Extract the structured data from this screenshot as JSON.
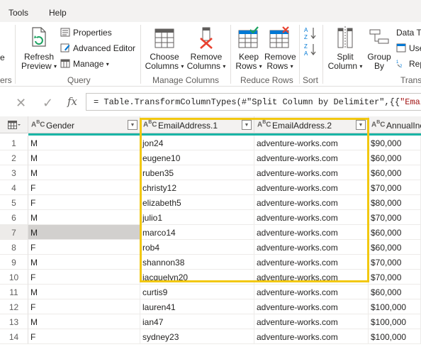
{
  "menu": {
    "tools": "Tools",
    "help": "Help"
  },
  "ribbon": {
    "left_fragments": {
      "top": "e",
      "bottom": "ers"
    },
    "refresh_preview": {
      "line1": "Refresh",
      "line2": "Preview"
    },
    "properties": "Properties",
    "advanced_editor": "Advanced Editor",
    "manage": "Manage",
    "query_group": "Query",
    "choose_columns": {
      "line1": "Choose",
      "line2": "Columns"
    },
    "remove_columns": {
      "line1": "Remove",
      "line2": "Columns"
    },
    "manage_columns_group": "Manage Columns",
    "keep_rows": {
      "line1": "Keep",
      "line2": "Rows"
    },
    "remove_rows": {
      "line1": "Remove",
      "line2": "Rows"
    },
    "reduce_rows_group": "Reduce Rows",
    "sort_group": "Sort",
    "split_column": {
      "line1": "Split",
      "line2": "Column"
    },
    "group_by": {
      "line1": "Group",
      "line2": "By"
    },
    "data_type": "Data Ty",
    "use_first_row": "Use",
    "replace_values": "Rep",
    "transform_group": "Transf"
  },
  "formula_bar": {
    "cancel": "✕",
    "commit": "✓",
    "fx": "fx",
    "formula_prefix": "= Table.TransformColumnTypes(#\"Split Column by Delimiter\",{{",
    "formula_string": "\"EmailAddr"
  },
  "grid": {
    "headers": {
      "gender": "Gender",
      "email1": "EmailAddress.1",
      "email2": "EmailAddress.2",
      "income": "AnnualInc"
    },
    "type_icon": "ABC",
    "rows": [
      {
        "n": "1",
        "gender": "M",
        "email1": "jon24",
        "email2": "adventure-works.com",
        "income": "$90,000"
      },
      {
        "n": "2",
        "gender": "M",
        "email1": "eugene10",
        "email2": "adventure-works.com",
        "income": "$60,000"
      },
      {
        "n": "3",
        "gender": "M",
        "email1": "ruben35",
        "email2": "adventure-works.com",
        "income": "$60,000"
      },
      {
        "n": "4",
        "gender": "F",
        "email1": "christy12",
        "email2": "adventure-works.com",
        "income": "$70,000"
      },
      {
        "n": "5",
        "gender": "F",
        "email1": "elizabeth5",
        "email2": "adventure-works.com",
        "income": "$80,000"
      },
      {
        "n": "6",
        "gender": "M",
        "email1": "julio1",
        "email2": "adventure-works.com",
        "income": "$70,000"
      },
      {
        "n": "7",
        "gender": "M",
        "email1": "marco14",
        "email2": "adventure-works.com",
        "income": "$60,000"
      },
      {
        "n": "8",
        "gender": "F",
        "email1": "rob4",
        "email2": "adventure-works.com",
        "income": "$60,000"
      },
      {
        "n": "9",
        "gender": "M",
        "email1": "shannon38",
        "email2": "adventure-works.com",
        "income": "$70,000"
      },
      {
        "n": "10",
        "gender": "F",
        "email1": "jacquelyn20",
        "email2": "adventure-works.com",
        "income": "$70,000"
      },
      {
        "n": "11",
        "gender": "M",
        "email1": "curtis9",
        "email2": "adventure-works.com",
        "income": "$60,000"
      },
      {
        "n": "12",
        "gender": "F",
        "email1": "lauren41",
        "email2": "adventure-works.com",
        "income": "$100,000"
      },
      {
        "n": "13",
        "gender": "M",
        "email1": "ian47",
        "email2": "adventure-works.com",
        "income": "$100,000"
      },
      {
        "n": "14",
        "gender": "F",
        "email1": "sydney23",
        "email2": "adventure-works.com",
        "income": "$100,000"
      }
    ],
    "selected_row": "7"
  },
  "colors": {
    "highlight": "#f2c811",
    "quality_bar": "#1ab5a6",
    "accent": "#0078d4"
  }
}
